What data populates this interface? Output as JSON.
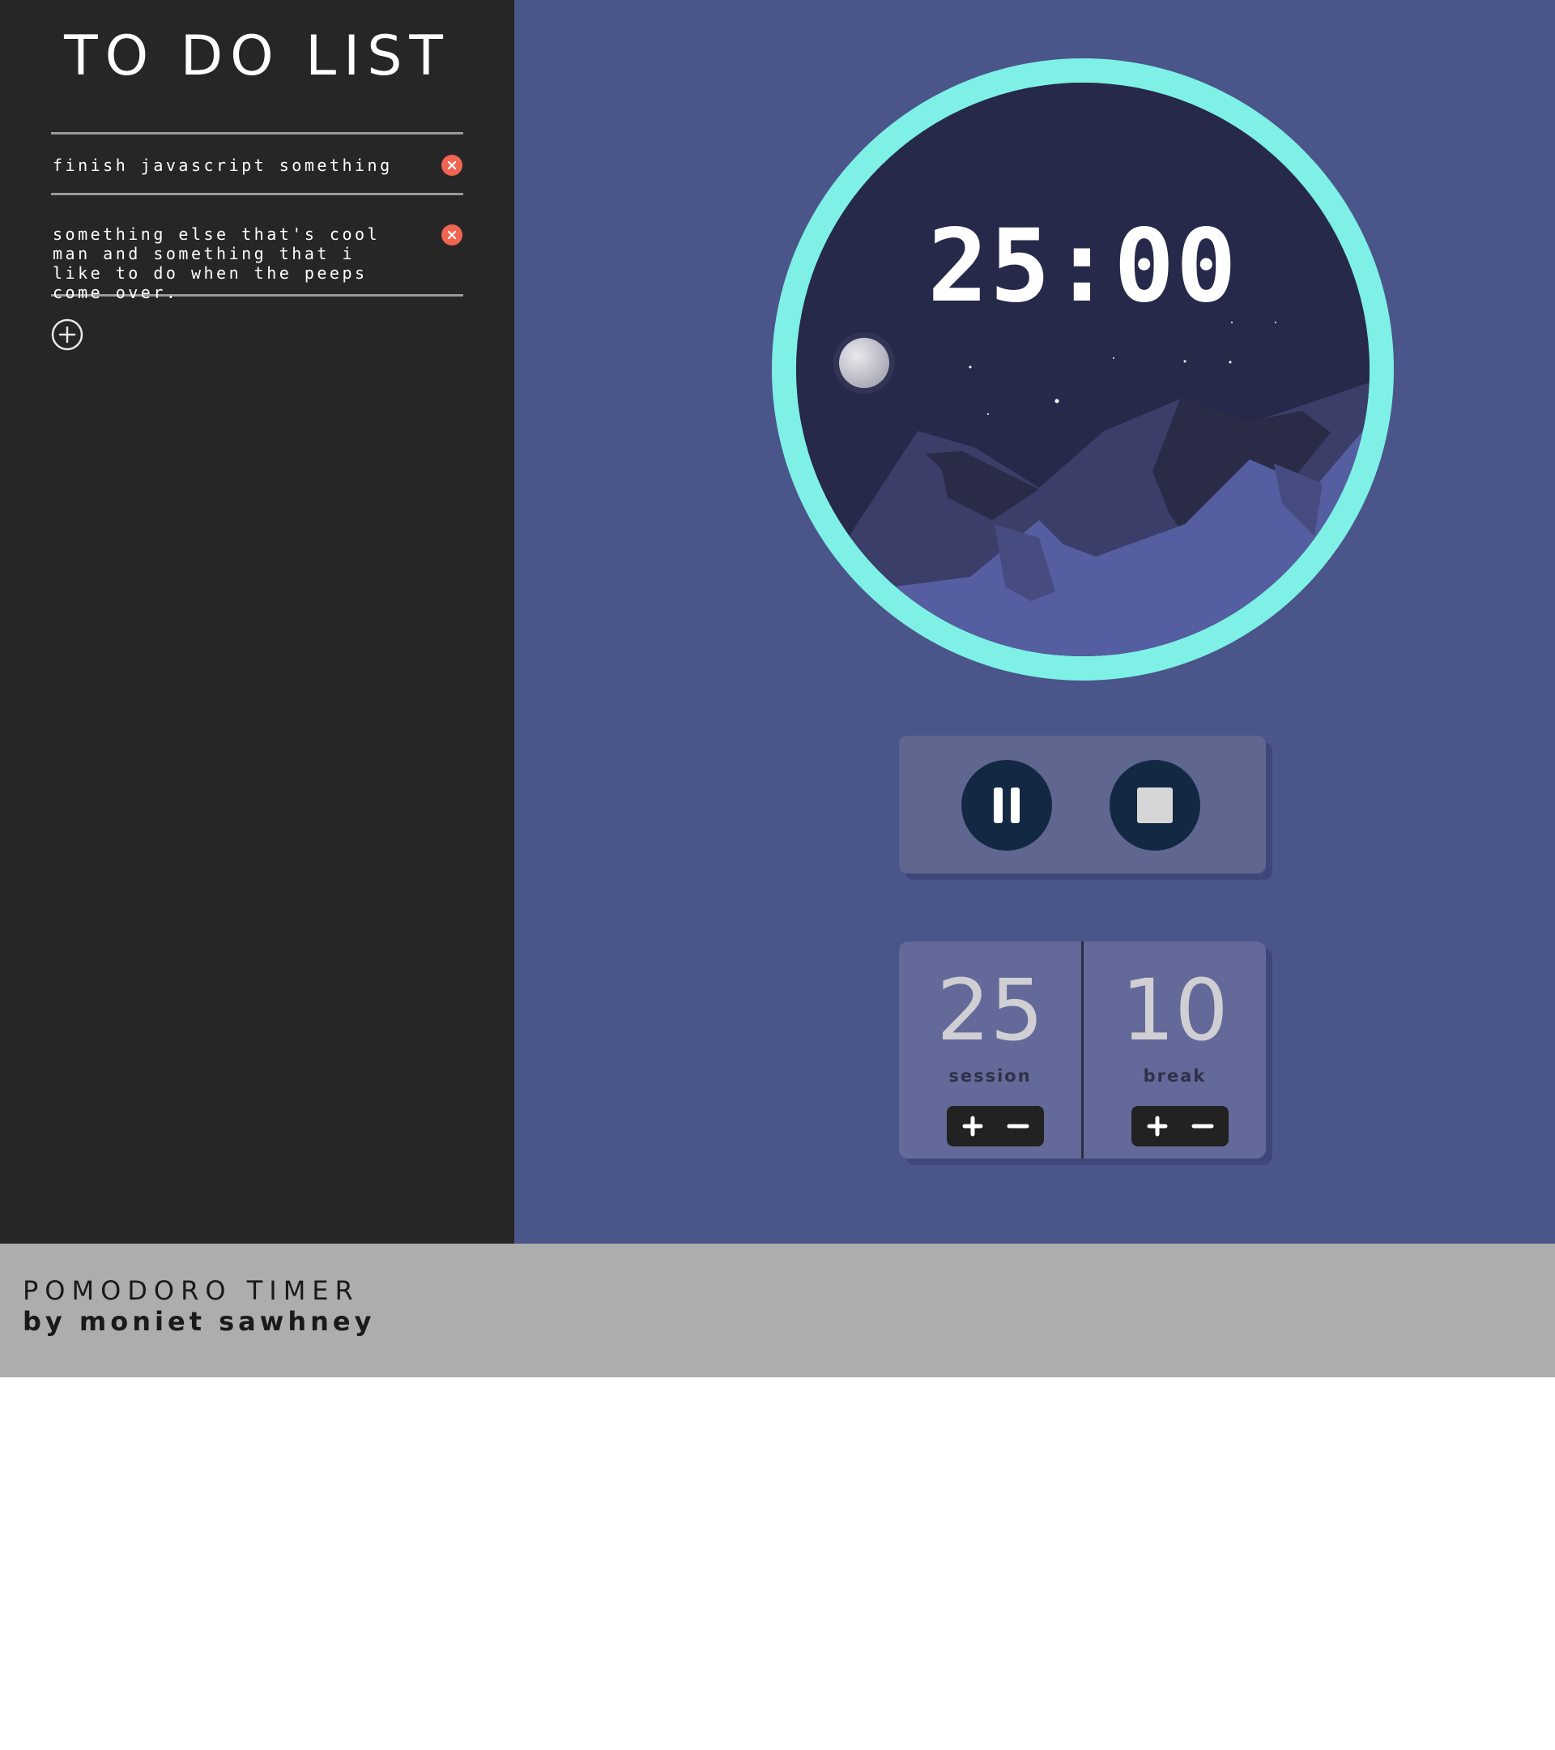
{
  "sidebar": {
    "title": "TO DO LIST",
    "todos": [
      {
        "text": "finish javascript something"
      },
      {
        "text": "something else that's cool man and something that i like to do when the peeps come over."
      }
    ],
    "icons": {
      "delete": "close-icon",
      "add": "plus-circle-icon",
      "collapse": "chevron-left-icon"
    }
  },
  "timer": {
    "display": "25:00",
    "ring_color": "#7ef0e6",
    "scene": {
      "sky": "#27294a",
      "moon": "#d6d6dc"
    }
  },
  "controls": {
    "pause_icon": "pause-icon",
    "stop_icon": "stop-icon"
  },
  "lengths": {
    "session": {
      "value": "25",
      "label": "session"
    },
    "break": {
      "value": "10",
      "label": "break"
    }
  },
  "footer": {
    "title": "POMODORO TIMER",
    "author": "by moniet sawhney"
  },
  "colors": {
    "sidebar_bg": "#262626",
    "main_bg": "#4a558a",
    "accent": "#7ef0e6",
    "delete": "#ef6552",
    "footer_bg": "#adadad"
  }
}
